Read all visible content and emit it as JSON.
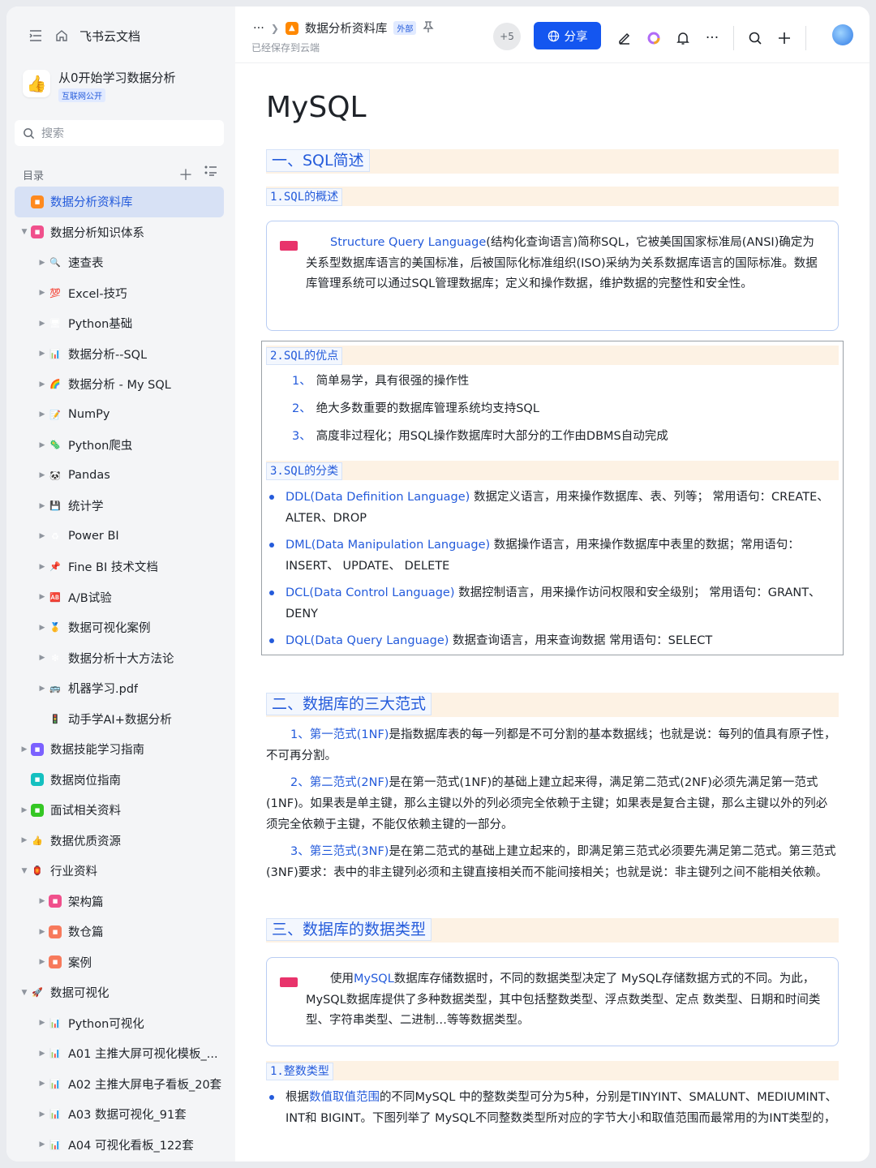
{
  "app": {
    "name": "飞书云文档"
  },
  "space": {
    "title": "从0开始学习数据分析",
    "tag": "互联网公开",
    "logo_emoji": "👍"
  },
  "search": {
    "placeholder": "搜索"
  },
  "toc": {
    "label": "目录"
  },
  "tree": [
    {
      "label": "数据分析资料库",
      "level": 0,
      "arrow": "",
      "icon": "orange",
      "active": true
    },
    {
      "label": "数据分析知识体系",
      "level": 0,
      "arrow": "▼",
      "icon": "pink"
    },
    {
      "label": "速查表",
      "level": 1,
      "arrow": "▶",
      "icon": "🔍"
    },
    {
      "label": "Excel-技巧",
      "level": 1,
      "arrow": "▶",
      "icon": "💯"
    },
    {
      "label": "Python基础",
      "level": 1,
      "arrow": "▶",
      "icon": "🖥"
    },
    {
      "label": "数据分析--SQL",
      "level": 1,
      "arrow": "▶",
      "icon": "📊"
    },
    {
      "label": "数据分析 - My SQL",
      "level": 1,
      "arrow": "▶",
      "icon": "🌈"
    },
    {
      "label": "NumPy",
      "level": 1,
      "arrow": "▶",
      "icon": "📝"
    },
    {
      "label": "Python爬虫",
      "level": 1,
      "arrow": "▶",
      "icon": "🦠"
    },
    {
      "label": "Pandas",
      "level": 1,
      "arrow": "▶",
      "icon": "🐼"
    },
    {
      "label": "统计学",
      "level": 1,
      "arrow": "▶",
      "icon": "💾"
    },
    {
      "label": "Power BI",
      "level": 1,
      "arrow": "▶",
      "icon": "♻"
    },
    {
      "label": "Fine BI 技术文档",
      "level": 1,
      "arrow": "▶",
      "icon": "📌"
    },
    {
      "label": "A/B试验",
      "level": 1,
      "arrow": "▶",
      "icon": "🆎"
    },
    {
      "label": "数据可视化案例",
      "level": 1,
      "arrow": "▶",
      "icon": "🥇"
    },
    {
      "label": "数据分析十大方法论",
      "level": 1,
      "arrow": "▶",
      "icon": "❇"
    },
    {
      "label": "机器学习.pdf",
      "level": 1,
      "arrow": "▶",
      "icon": "🚌"
    },
    {
      "label": "动手学AI+数据分析",
      "level": 1,
      "arrow": "",
      "icon": "🚦"
    },
    {
      "label": "数据技能学习指南",
      "level": 0,
      "arrow": "▶",
      "icon": "purple"
    },
    {
      "label": "数据岗位指南",
      "level": 0,
      "arrow": "",
      "icon": "teal"
    },
    {
      "label": "面试相关资料",
      "level": 0,
      "arrow": "▶",
      "icon": "green"
    },
    {
      "label": "数据优质资源",
      "level": 0,
      "arrow": "▶",
      "icon": "👍"
    },
    {
      "label": "行业资料",
      "level": 0,
      "arrow": "▼",
      "icon": "🏮"
    },
    {
      "label": "架构篇",
      "level": 1,
      "arrow": "▶",
      "icon": "pink"
    },
    {
      "label": "数仓篇",
      "level": 1,
      "arrow": "▶",
      "icon": "salmon"
    },
    {
      "label": "案例",
      "level": 1,
      "arrow": "▶",
      "icon": "salmon"
    },
    {
      "label": "数据可视化",
      "level": 0,
      "arrow": "▼",
      "icon": "🚀"
    },
    {
      "label": "Python可视化",
      "level": 1,
      "arrow": "▶",
      "icon": "📊"
    },
    {
      "label": "A01 主推大屏可视化模板_...",
      "level": 1,
      "arrow": "▶",
      "icon": "📊"
    },
    {
      "label": "A02 主推大屏电子看板_20套",
      "level": 1,
      "arrow": "▶",
      "icon": "📊"
    },
    {
      "label": "A03 数据可视化_91套",
      "level": 1,
      "arrow": "▶",
      "icon": "📊"
    },
    {
      "label": "A04 可视化看板_122套",
      "level": 1,
      "arrow": "▶",
      "icon": "📊"
    }
  ],
  "header": {
    "crumb_more": "···",
    "doc_name": "数据分析资料库",
    "ext_tag": "外部",
    "saved": "已经保存到云端",
    "collaborators": "+5",
    "share_label": "分享"
  },
  "doc": {
    "title": "MySQL",
    "s1": "一、SQL简述",
    "s1_1": "1.SQL的概述",
    "callout1_link": "Structure Query Language",
    "callout1_text": "(结构化查询语言)简称SQL，它被美国国家标准局(ANSI)确定为关系型数据库语言的美国标准，后被国际化标准组织(ISO)采纳为关系数据库语言的国际标准。数据库管理系统可以通过SQL管理数据库；定义和操作数据，维护数据的完整性和安全性。",
    "s1_2": "2.SQL的优点",
    "adv": [
      {
        "n": "1、",
        "t": "简单易学，具有很强的操作性"
      },
      {
        "n": "2、",
        "t": "绝大多数重要的数据库管理系统均支持SQL"
      },
      {
        "n": "3、",
        "t": "高度非过程化；用SQL操作数据库时大部分的工作由DBMS自动完成"
      }
    ],
    "s1_3": "3.SQL的分类",
    "cats": [
      {
        "link": "DDL(Data Definition Language)",
        "t": " 数据定义语言，用来操作数据库、表、列等； 常用语句：CREATE、 ALTER、DROP"
      },
      {
        "link": "DML(Data Manipulation Language)",
        "t": " 数据操作语言，用来操作数据库中表里的数据；常用语句：INSERT、 UPDATE、 DELETE"
      },
      {
        "link": "DCL(Data Control Language)",
        "t": " 数据控制语言，用来操作访问权限和安全级别； 常用语句：GRANT、DENY"
      },
      {
        "link": "DQL(Data Query Language)",
        "t": " 数据查询语言，用来查询数据 常用语句：SELECT"
      }
    ],
    "s2": "二、数据库的三大范式",
    "nf": [
      {
        "n": "1、",
        "link": "第一范式(1NF)",
        "t": "是指数据库表的每一列都是不可分割的基本数据线；也就是说：每列的值具有原子性，不可再分割。"
      },
      {
        "n": "2、",
        "link": "第二范式(2NF)",
        "t": "是在第一范式(1NF)的基础上建立起来得，满足第二范式(2NF)必须先满足第一范式(1NF)。如果表是单主键，那么主键以外的列必须完全依赖于主键；如果表是复合主键，那么主键以外的列必须完全依赖于主键，不能仅依赖主键的一部分。"
      },
      {
        "n": "3、",
        "link": "第三范式(3NF)",
        "t": "是在第二范式的基础上建立起来的，即满足第三范式必须要先满足第二范式。第三范式(3NF)要求：表中的非主键列必须和主键直接相关而不能间接相关；也就是说：非主键列之间不能相关依赖。"
      }
    ],
    "s3": "三、数据库的数据类型",
    "callout2_pre": "使用",
    "callout2_link": "MySQL",
    "callout2_text": "数据库存储数据时，不同的数据类型决定了 MySQL存储数据方式的不同。为此，MySQL数据库提供了多种数据类型，其中包括整数类型、浮点数类型、定点 数类型、日期和时间类型、字符串类型、二进制…等等数据类型。",
    "s3_1": "1.整数类型",
    "int_pre": "根据",
    "int_link": "数值取值范围",
    "int_text": "的不同MySQL 中的整数类型可分为5种，分别是TINYINT、SMALUNT、MEDIUMINT、INT和 BIGINT。下图列举了 MySQL不同整数类型所对应的字节大小和取值范围而最常用的为INT类型的，"
  },
  "colors": {
    "accent": "#1456f0",
    "link": "#245bdb",
    "heading_band": "#fdf2e4"
  }
}
